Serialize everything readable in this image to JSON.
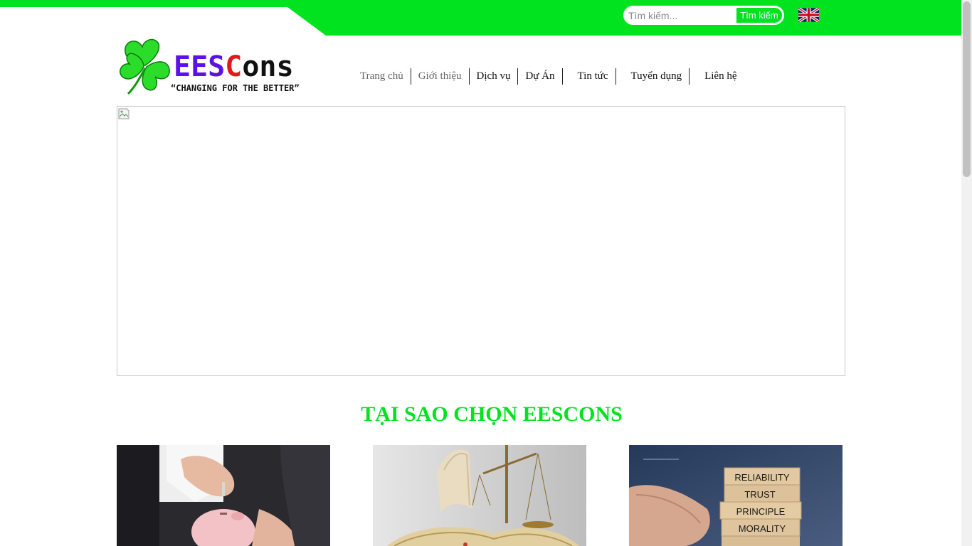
{
  "search": {
    "placeholder": "Tìm kiếm...",
    "button_label": "Tìm kiếm"
  },
  "language": {
    "icon": "uk-flag-icon"
  },
  "logo": {
    "word_part1": "EES",
    "word_part2": "C",
    "word_part3": "ons",
    "tagline": "“CHANGING FOR THE BETTER”",
    "icon": "clover-icon"
  },
  "nav": {
    "items": [
      {
        "label": "Trang chủ"
      },
      {
        "label": "Giới thiệu"
      },
      {
        "label": "Dịch vụ"
      },
      {
        "label": "Dự Án"
      },
      {
        "label": "Tin tức"
      },
      {
        "label": "Tuyển dụng"
      },
      {
        "label": "Liên hệ"
      }
    ]
  },
  "banner": {
    "icon": "broken-image-icon"
  },
  "why_section": {
    "title": "TẠI SAO CHỌN EESCONS",
    "cards": [
      {
        "image": "piggy-bank-savings"
      },
      {
        "image": "book-and-scales-of-justice"
      },
      {
        "image": "wooden-blocks",
        "block_words": [
          "RELIABILITY",
          "TRUST",
          "PRINCIPLE",
          "MORALITY"
        ]
      }
    ]
  },
  "colors": {
    "brand_green": "#00e31e",
    "logo_purple": "#5b12e6",
    "logo_red": "#e51818"
  }
}
